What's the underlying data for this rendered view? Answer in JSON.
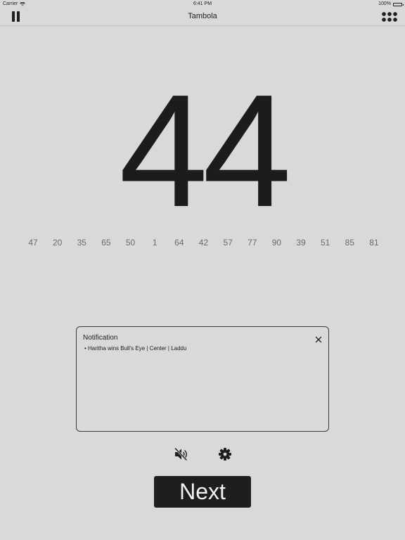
{
  "status_bar": {
    "carrier": "Carrier",
    "time": "6:41 PM",
    "battery": "100%"
  },
  "nav": {
    "title": "Tambola"
  },
  "current_number": "44",
  "history": [
    "47",
    "20",
    "35",
    "65",
    "50",
    "1",
    "64",
    "42",
    "57",
    "77",
    "90",
    "39",
    "51",
    "85",
    "81"
  ],
  "notification": {
    "title": "Notification",
    "items": [
      "Haritha wins Bull's Eye | Center | Laddu"
    ]
  },
  "next_button": {
    "label": "Next"
  },
  "icons": {
    "pause": "pause-icon",
    "menu": "grid-menu-icon",
    "close": "close-icon",
    "mute": "speaker-muted-icon",
    "settings": "gear-icon",
    "wifi": "wifi-icon",
    "battery": "battery-icon"
  },
  "colors": {
    "background": "#d9d9d9",
    "text": "#1e1e1e",
    "history_text": "#6b6b6b",
    "button_bg": "#1e1e1e",
    "button_text": "#f2f2f2"
  }
}
